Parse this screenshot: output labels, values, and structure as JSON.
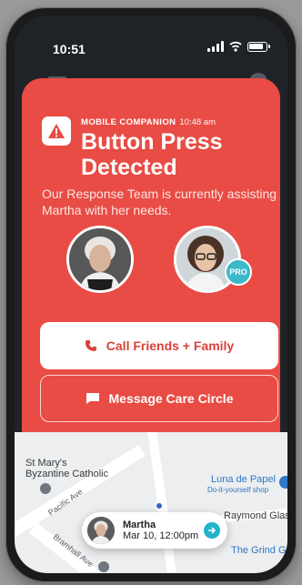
{
  "status_bar": {
    "time": "10:51"
  },
  "alert": {
    "eyebrow_app": "MOBILE COMPANION",
    "eyebrow_time": "10:48 am",
    "title": "Button Press Detected",
    "subtitle": "Our Response Team is currently assisting Martha with her needs.",
    "pro_badge": "PRO",
    "primary_button": "Call Friends + Family",
    "secondary_button": "Message Care Circle",
    "colors": {
      "background": "#e84c45",
      "primary_text": "#d94139",
      "badge": "#3bb9c9"
    }
  },
  "map": {
    "places": [
      {
        "id": "church",
        "label_line1": "St Mary's",
        "label_line2": "Byzantine Catholic"
      },
      {
        "id": "shop",
        "label": "Luna de Papel",
        "sublabel": "Do-it-yourself shop"
      },
      {
        "id": "raymond",
        "label": "Raymond Glass"
      },
      {
        "id": "grind",
        "label": "The Grind Gen"
      }
    ],
    "roads": [
      "Pacific Ave",
      "Bramhall Ave"
    ]
  },
  "event_card": {
    "name": "Martha",
    "datetime": "Mar 10, 12:00pm"
  }
}
